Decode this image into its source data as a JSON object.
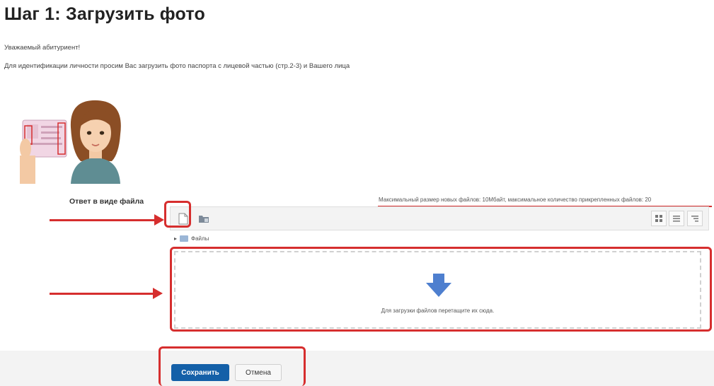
{
  "page": {
    "title": "Шаг 1: Загрузить фото",
    "greeting": "Уважаемый абитуриент!",
    "instruction": "Для идентификации личности просим Вас загрузить фото паспорта с лицевой частью (стр.2-3) и Вашего лица"
  },
  "illustration": {
    "icon": "woman-holding-passport-image"
  },
  "upload": {
    "label": "Ответ в виде файла",
    "max_info": "Максимальный размер новых файлов: 10Мбайт, максимальное количество прикрепленных файлов: 20",
    "toolbar": {
      "add_icon": "add-file-icon",
      "folder_icon": "create-folder-icon",
      "view_icons": [
        "view-icons-icon",
        "view-list-icon",
        "view-tree-icon"
      ]
    },
    "breadcrumb": "Файлы",
    "drop_text": "Для загрузки файлов перетащите их сюда."
  },
  "actions": {
    "save_label": "Сохранить",
    "cancel_label": "Отмена"
  },
  "colors": {
    "highlight": "#d62e2e",
    "primary_button": "#1460a8",
    "drop_arrow": "#4e7fcf"
  }
}
